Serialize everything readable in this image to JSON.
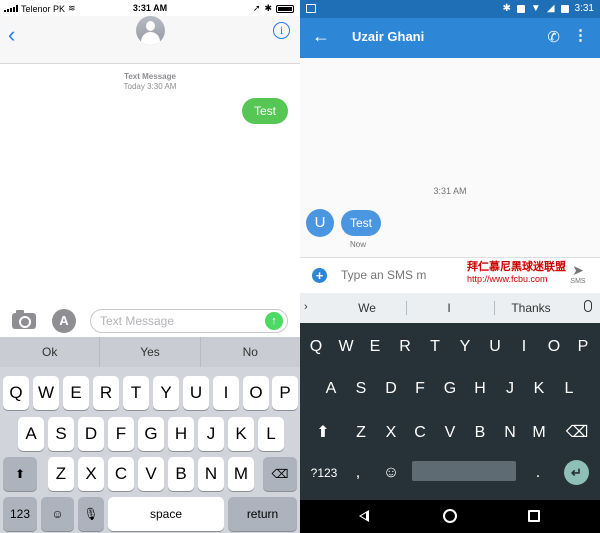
{
  "ios": {
    "status": {
      "carrier": "Telenor PK",
      "time": "3:31 AM"
    },
    "nav": {
      "back_glyph": "‹",
      "info_glyph": "i"
    },
    "thread": {
      "label": "Text Message",
      "timestamp": "Today 3:30 AM",
      "message": "Test"
    },
    "compose": {
      "placeholder": "Text Message",
      "appstore_glyph": "A",
      "send_glyph": "↑"
    },
    "keyboard": {
      "suggestions": [
        "Ok",
        "Yes",
        "No"
      ],
      "row1": [
        "Q",
        "W",
        "E",
        "R",
        "T",
        "Y",
        "U",
        "I",
        "O",
        "P"
      ],
      "row2": [
        "A",
        "S",
        "D",
        "F",
        "G",
        "H",
        "J",
        "K",
        "L"
      ],
      "row3": [
        "Z",
        "X",
        "C",
        "V",
        "B",
        "N",
        "M"
      ],
      "shift_glyph": "⬆",
      "delete_glyph": "⌫",
      "numbers": "123",
      "emoji_glyph": "☺",
      "mic_glyph": "🎙",
      "space": "space",
      "return": "return"
    }
  },
  "android": {
    "status": {
      "time": "3:31"
    },
    "appbar": {
      "back_glyph": "←",
      "title": "Uzair Ghani",
      "call_glyph": "✆",
      "more_glyph": "⋮"
    },
    "thread": {
      "time": "3:31 AM",
      "avatar_letter": "U",
      "message": "Test",
      "status": "Now"
    },
    "compose": {
      "plus_glyph": "+",
      "placeholder": "Type an SMS m",
      "send_glyph": "➤",
      "send_label": "SMS"
    },
    "watermark": {
      "line1": "拜仁慕尼黑球迷联盟",
      "line2": "http://www.fcbu.com"
    },
    "keyboard": {
      "chevron_glyph": "›",
      "suggestions": [
        "We",
        "I",
        "Thanks"
      ],
      "row1": [
        "Q",
        "W",
        "E",
        "R",
        "T",
        "Y",
        "U",
        "I",
        "O",
        "P"
      ],
      "row2": [
        "A",
        "S",
        "D",
        "F",
        "G",
        "H",
        "J",
        "K",
        "L"
      ],
      "row3": [
        "Z",
        "X",
        "C",
        "V",
        "B",
        "N",
        "M"
      ],
      "shift_glyph": "⬆",
      "delete_glyph": "⌫",
      "symbols": "?123",
      "comma": ",",
      "emoji_glyph": "☺",
      "period": ".",
      "enter_glyph": "↵"
    }
  }
}
